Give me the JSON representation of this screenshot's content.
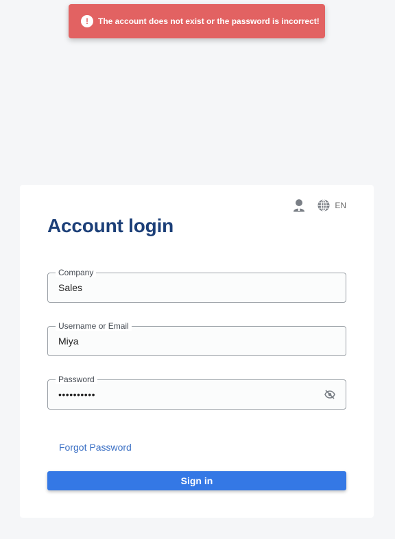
{
  "toast": {
    "icon": "exclamation-icon",
    "icon_glyph": "!",
    "message": "The account does not exist or the password is incorrect!",
    "color": "#e26262"
  },
  "header_actions": {
    "user_icon": "user-icon",
    "language_icon": "globe-icon",
    "language_code": "EN"
  },
  "login": {
    "title": "Account login",
    "fields": {
      "company": {
        "label": "Company",
        "value": "Sales"
      },
      "username": {
        "label": "Username or Email",
        "value": "Miya"
      },
      "password": {
        "label": "Password",
        "value": "••••••••••",
        "toggle_icon": "eye-off-icon"
      }
    },
    "forgot_password": "Forgot Password",
    "signin": "Sign in"
  },
  "colors": {
    "primary": "#3478e5",
    "title": "#1c3f78",
    "link": "#3a6fc4",
    "background": "#f5f6f8"
  }
}
